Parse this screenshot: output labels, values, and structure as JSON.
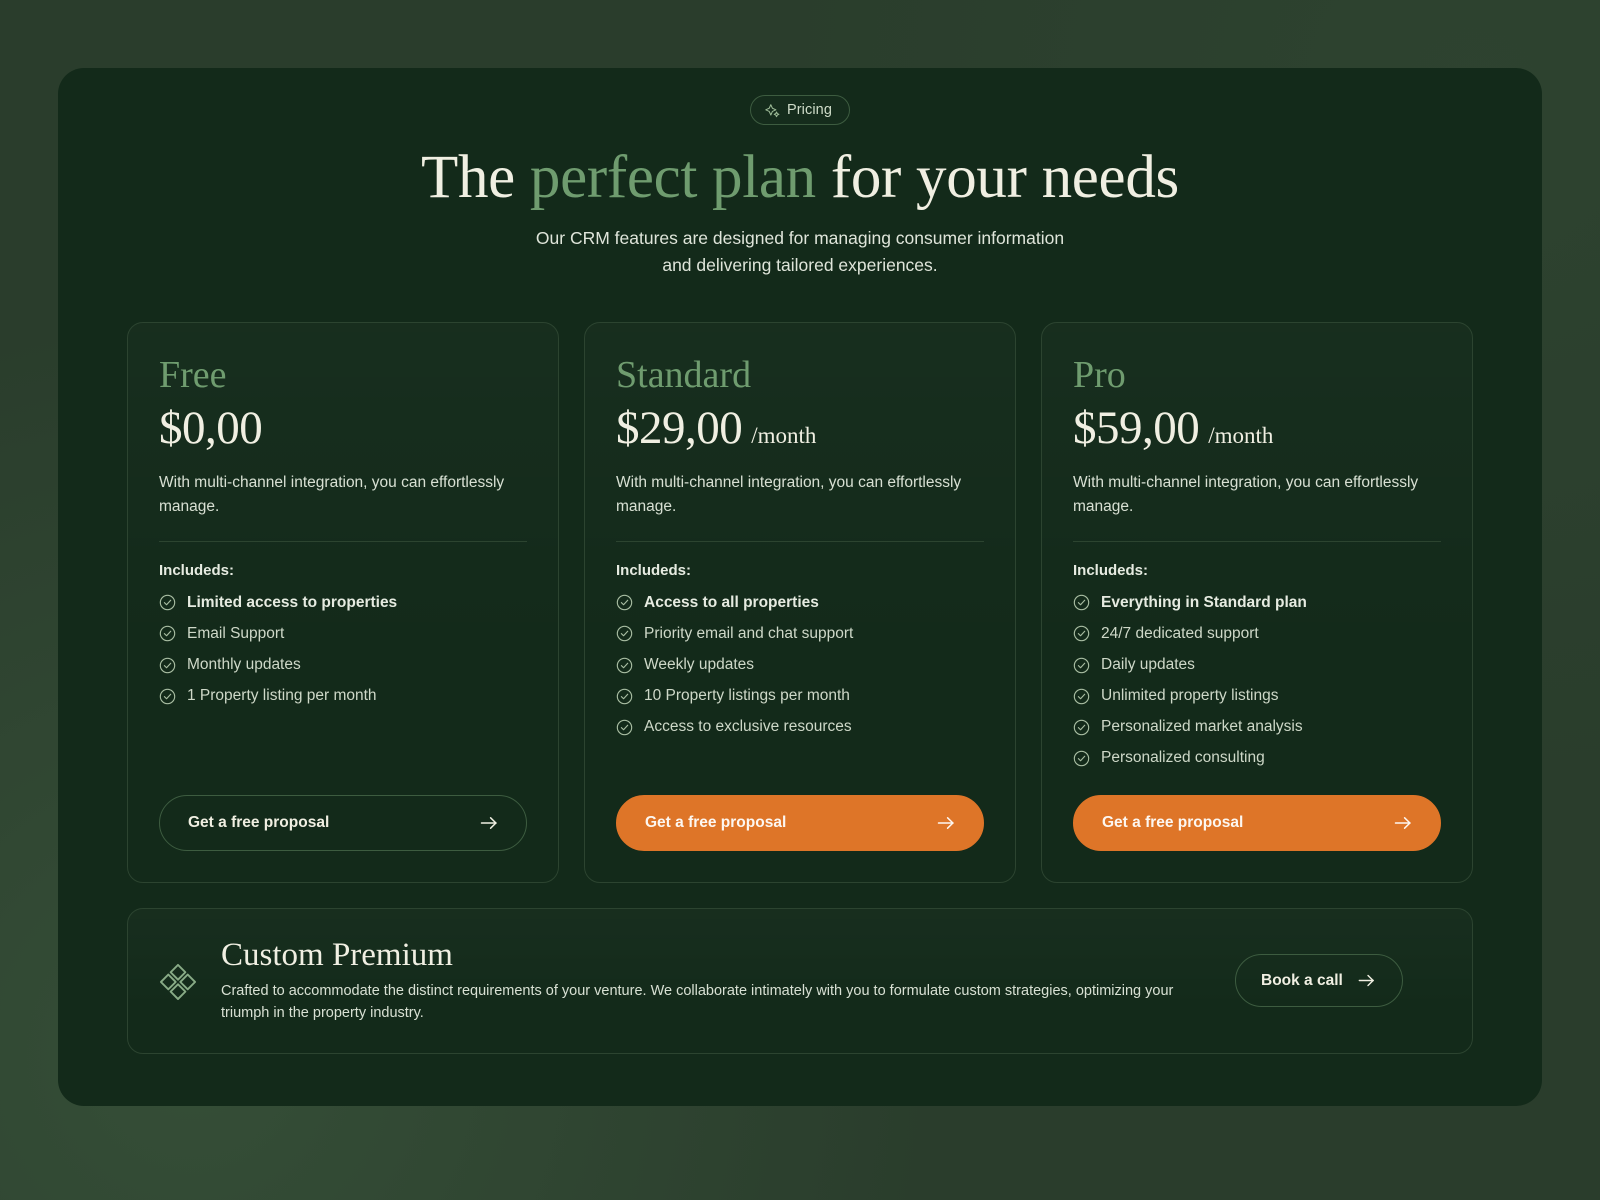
{
  "header": {
    "badge_label": "Pricing",
    "badge_icon": "sparkle-icon",
    "headline_part1": "The ",
    "headline_accent": "perfect plan",
    "headline_part2": " for your needs",
    "subhead_line1": "Our CRM features are designed for managing consumer information",
    "subhead_line2": "and delivering tailored experiences."
  },
  "colors": {
    "page_background": "#2a3d2c",
    "panel_background": "#132a1a",
    "accent_green": "#6f9c6f",
    "accent_orange": "#de7528",
    "text_cream": "#f0efe2",
    "border": "#2c4430"
  },
  "plans": [
    {
      "name": "Free",
      "price": "$0,00",
      "period": "",
      "description": "With multi-channel integration, you can effortlessly manage.",
      "includes_label": "Includeds:",
      "features": [
        "Limited access to properties",
        "Email Support",
        "Monthly updates",
        "1 Property listing per month"
      ],
      "cta_label": "Get a free proposal",
      "cta_style": "outline"
    },
    {
      "name": "Standard",
      "price": "$29,00",
      "period": "/month",
      "description": "With multi-channel integration, you can effortlessly manage.",
      "includes_label": "Includeds:",
      "features": [
        "Access to all properties",
        "Priority email and chat support",
        "Weekly updates",
        "10 Property listings per month",
        "Access to exclusive resources"
      ],
      "cta_label": "Get a free proposal",
      "cta_style": "solid"
    },
    {
      "name": "Pro",
      "price": "$59,00",
      "period": "/month",
      "description": "With multi-channel integration, you can effortlessly manage.",
      "includes_label": "Includeds:",
      "features": [
        "Everything in Standard plan",
        "24/7 dedicated support",
        "Daily updates",
        "Unlimited property listings",
        "Personalized market analysis",
        "Personalized consulting"
      ],
      "cta_label": "Get a free proposal",
      "cta_style": "solid"
    }
  ],
  "premium": {
    "icon": "diamond-cluster-icon",
    "title": "Custom Premium",
    "description": "Crafted to accommodate the distinct requirements of your venture. We collaborate intimately with you to formulate custom strategies, optimizing your triumph in the property industry.",
    "cta_label": "Book a call"
  }
}
